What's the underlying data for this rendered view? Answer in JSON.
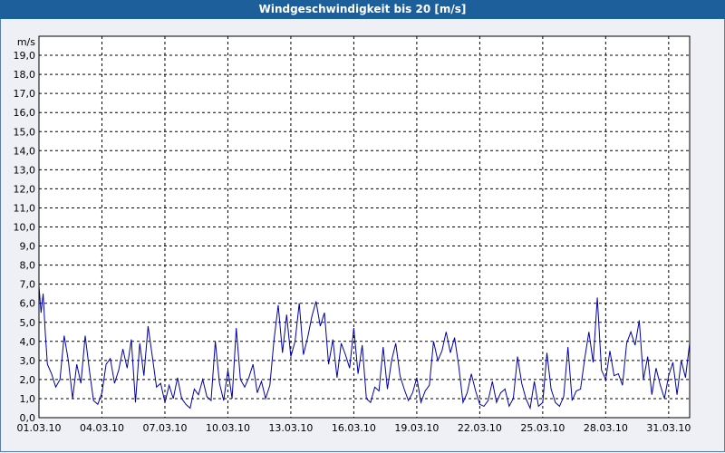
{
  "window": {
    "title": "Windgeschwindigkeit bis 20 [m/s]"
  },
  "colors": {
    "title_bar": "#1d5f9b",
    "background": "#eef0f6",
    "plot_bg": "#ffffff",
    "series": "#0000aa",
    "grid": "#000000"
  },
  "chart_data": {
    "type": "line",
    "title": "Windgeschwindigkeit bis 20 [m/s]",
    "ylabel": "m/s",
    "xlabel": "",
    "ylim": [
      0,
      20
    ],
    "xlim_days": [
      1,
      32
    ],
    "grid": true,
    "y_ticks": [
      "0,0",
      "1,0",
      "2,0",
      "3,0",
      "4,0",
      "5,0",
      "6,0",
      "7,0",
      "8,0",
      "9,0",
      "10,0",
      "11,0",
      "12,0",
      "13,0",
      "14,0",
      "15,0",
      "16,0",
      "17,0",
      "18,0",
      "19,0"
    ],
    "x_ticks": [
      "01.03.10",
      "04.03.10",
      "07.03.10",
      "10.03.10",
      "13.03.10",
      "16.03.10",
      "19.03.10",
      "22.03.10",
      "25.03.10",
      "28.03.10",
      "31.03.10"
    ],
    "series": [
      {
        "x_day": [
          1.0,
          1.1,
          1.2,
          1.3,
          1.4,
          1.6,
          1.8,
          2.0,
          2.2,
          2.4,
          2.6,
          2.8,
          3.0,
          3.2,
          3.4,
          3.6,
          3.8,
          4.0,
          4.2,
          4.4,
          4.6,
          4.8,
          5.0,
          5.2,
          5.4,
          5.6,
          5.8,
          6.0,
          6.2,
          6.4,
          6.6,
          6.8,
          7.0,
          7.2,
          7.4,
          7.6,
          7.8,
          8.0,
          8.2,
          8.4,
          8.6,
          8.8,
          9.0,
          9.2,
          9.4,
          9.6,
          9.8,
          10.0,
          10.2,
          10.4,
          10.6,
          10.8,
          11.0,
          11.2,
          11.4,
          11.6,
          11.8,
          12.0,
          12.2,
          12.4,
          12.6,
          12.8,
          13.0,
          13.2,
          13.4,
          13.6,
          13.8,
          14.0,
          14.2,
          14.4,
          14.6,
          14.8,
          15.0,
          15.2,
          15.4,
          15.6,
          15.8,
          16.0,
          16.2,
          16.4,
          16.6,
          16.8,
          17.0,
          17.2,
          17.4,
          17.6,
          17.8,
          18.0,
          18.2,
          18.4,
          18.6,
          18.8,
          19.0,
          19.2,
          19.4,
          19.6,
          19.8,
          20.0,
          20.2,
          20.4,
          20.6,
          20.8,
          21.0,
          21.2,
          21.4,
          21.6,
          21.8,
          22.0,
          22.2,
          22.4,
          22.6,
          22.8,
          23.0,
          23.2,
          23.4,
          23.6,
          23.8,
          24.0,
          24.2,
          24.4,
          24.6,
          24.8,
          25.0,
          25.2,
          25.4,
          25.6,
          25.8,
          26.0,
          26.2,
          26.4,
          26.6,
          26.8,
          27.0,
          27.2,
          27.4,
          27.6,
          27.8,
          28.0,
          28.2,
          28.4,
          28.6,
          28.8,
          29.0,
          29.2,
          29.4,
          29.6,
          29.8,
          30.0,
          30.2,
          30.4,
          30.6,
          30.8,
          31.0,
          31.2,
          31.4,
          31.6,
          31.8,
          32.0
        ],
        "values": [
          6.9,
          5.5,
          6.5,
          4.5,
          2.8,
          2.3,
          1.6,
          2.0,
          4.3,
          3.0,
          1.0,
          2.8,
          1.8,
          4.3,
          2.5,
          0.9,
          0.7,
          1.3,
          2.8,
          3.1,
          1.8,
          2.5,
          3.6,
          2.6,
          4.1,
          0.8,
          3.9,
          2.2,
          4.8,
          3.2,
          1.6,
          1.8,
          0.8,
          1.7,
          1.0,
          2.1,
          1.0,
          0.7,
          0.5,
          1.5,
          1.2,
          2.0,
          1.1,
          0.9,
          4.0,
          1.8,
          0.9,
          2.5,
          1.0,
          4.7,
          2.0,
          1.6,
          2.1,
          2.8,
          1.3,
          1.9,
          1.0,
          1.7,
          4.1,
          5.9,
          3.4,
          5.4,
          3.2,
          4.0,
          6.0,
          3.3,
          4.2,
          5.3,
          6.1,
          4.8,
          5.5,
          2.8,
          4.1,
          2.1,
          3.9,
          3.3,
          2.6,
          4.7,
          2.3,
          3.8,
          1.0,
          0.8,
          1.6,
          1.4,
          3.7,
          1.5,
          3.0,
          3.9,
          2.2,
          1.5,
          0.9,
          1.3,
          2.1,
          0.8,
          1.4,
          1.7,
          4.0,
          3.0,
          3.5,
          4.5,
          3.4,
          4.2,
          2.7,
          0.8,
          1.3,
          2.3,
          1.4,
          0.7,
          0.6,
          0.9,
          1.9,
          0.8,
          1.3,
          1.5,
          0.6,
          1.0,
          3.2,
          1.8,
          1.0,
          0.5,
          1.9,
          0.6,
          0.8,
          3.4,
          1.5,
          0.8,
          0.6,
          1.1,
          3.7,
          0.9,
          1.4,
          1.5,
          3.1,
          4.5,
          2.9,
          6.3,
          2.5,
          2.0,
          3.5,
          2.2,
          2.3,
          1.7,
          3.9,
          4.5,
          3.8,
          5.1,
          2.0,
          3.2,
          1.2,
          2.6,
          1.7,
          1.0,
          2.2,
          2.9,
          1.2,
          3.0,
          2.1,
          3.9,
          3.2,
          4.5,
          1.8
        ]
      }
    ]
  }
}
